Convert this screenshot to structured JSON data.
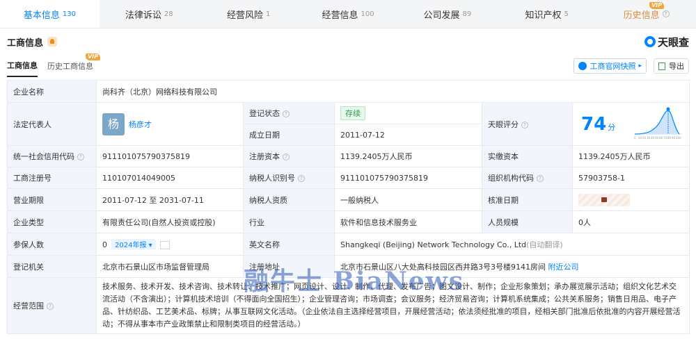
{
  "tabs": [
    {
      "label": "基本信息",
      "count": "130"
    },
    {
      "label": "法律诉讼",
      "count": "28"
    },
    {
      "label": "经营风险",
      "count": "1"
    },
    {
      "label": "经营信息",
      "count": "100"
    },
    {
      "label": "公司发展",
      "count": "89"
    },
    {
      "label": "知识产权",
      "count": "5"
    },
    {
      "label": "历史信息",
      "count": "",
      "vip": "VIP"
    }
  ],
  "section": {
    "title": "工商信息",
    "logo": "天眼查"
  },
  "subtabs": [
    {
      "label": "工商信息"
    },
    {
      "label": "历史工商信息",
      "vip": "VIP"
    }
  ],
  "buttons": {
    "official": "工商官网快照",
    "export": "导出"
  },
  "rows": {
    "company_name": {
      "label": "企业名称",
      "value": "尚科齐（北京）网络科技有限公司"
    },
    "legal_rep": {
      "label": "法定代表人",
      "avatar": "杨",
      "name": "杨彦才"
    },
    "reg_status": {
      "label": "登记状态",
      "value": "存续"
    },
    "found_date": {
      "label": "成立日期",
      "value": "2011-07-12"
    },
    "rating": {
      "label": "天眼评分",
      "score": "74",
      "unit": "分",
      "axis": [
        "0",
        "10",
        "20",
        "30",
        "40",
        "50",
        "60",
        "70",
        "80",
        "90",
        "100"
      ]
    },
    "credit_code": {
      "label": "统一社会信用代码",
      "value": "911101075790375819"
    },
    "reg_capital": {
      "label": "注册资本",
      "value": "1139.2405万人民币"
    },
    "paid_capital": {
      "label": "实缴资本",
      "value": "1139.2405万人民币"
    },
    "reg_no": {
      "label": "工商注册号",
      "value": "110107014049005"
    },
    "tax_id": {
      "label": "纳税人识别号",
      "value": "911101075790375819"
    },
    "org_code": {
      "label": "组织机构代码",
      "value": "57903758-1"
    },
    "term": {
      "label": "营业期限",
      "value": "2011-07-12 至 2031-07-11"
    },
    "tax_quality": {
      "label": "纳税人资质",
      "value": "一般纳税人"
    },
    "approve_date": {
      "label": "核准日期"
    },
    "type": {
      "label": "企业类型",
      "value": "有限责任公司(自然人投资或控股)"
    },
    "industry": {
      "label": "行业",
      "value": "软件和信息技术服务业"
    },
    "staff": {
      "label": "人员规模",
      "value": "0人"
    },
    "insured": {
      "label": "参保人数",
      "value": "0",
      "year": "2024年报"
    },
    "en_name": {
      "label": "英文名称",
      "value": "Shangkeqi (Beijing) Network Technology Co., Ltd",
      "hint": "(自动翻译)"
    },
    "authority": {
      "label": "登记机关",
      "value": "北京市石景山区市场监督管理局"
    },
    "address": {
      "label": "注册地址",
      "value": "北京市石景山区八大处高科技园区西井路3号3号楼9141房间",
      "link": "附近公司"
    },
    "scope": {
      "label": "经营范围",
      "value": "技术服务、技术开发、技术咨询、技术转让、技术推广；网页设计、设计、制作、代理、发布广告；图文设计、制作；企业形象策划；承办展览展示活动；组织文化艺术交流活动（不含演出）；计算机技术培训（不得面向全国招生）；企业管理咨询；市场调查；会议服务；经济贸易咨询；计算机系统集成；公共关系服务；销售日用品、电子产品、针纺织品、工艺美术品、标牌；从事互联网文化活动。（企业依法自主选择经营项目，开展经营活动；依法须经批准的项目，经相关部门批准后依批准的内容开展经营活动；不得从事本市产业政策禁止和限制类项目的经营活动。）"
    }
  },
  "watermark": "融牛士 BiaNews",
  "colors": {
    "accent": "#0084ff",
    "vip": "#f3a53a",
    "status_green": "#23a04b"
  }
}
